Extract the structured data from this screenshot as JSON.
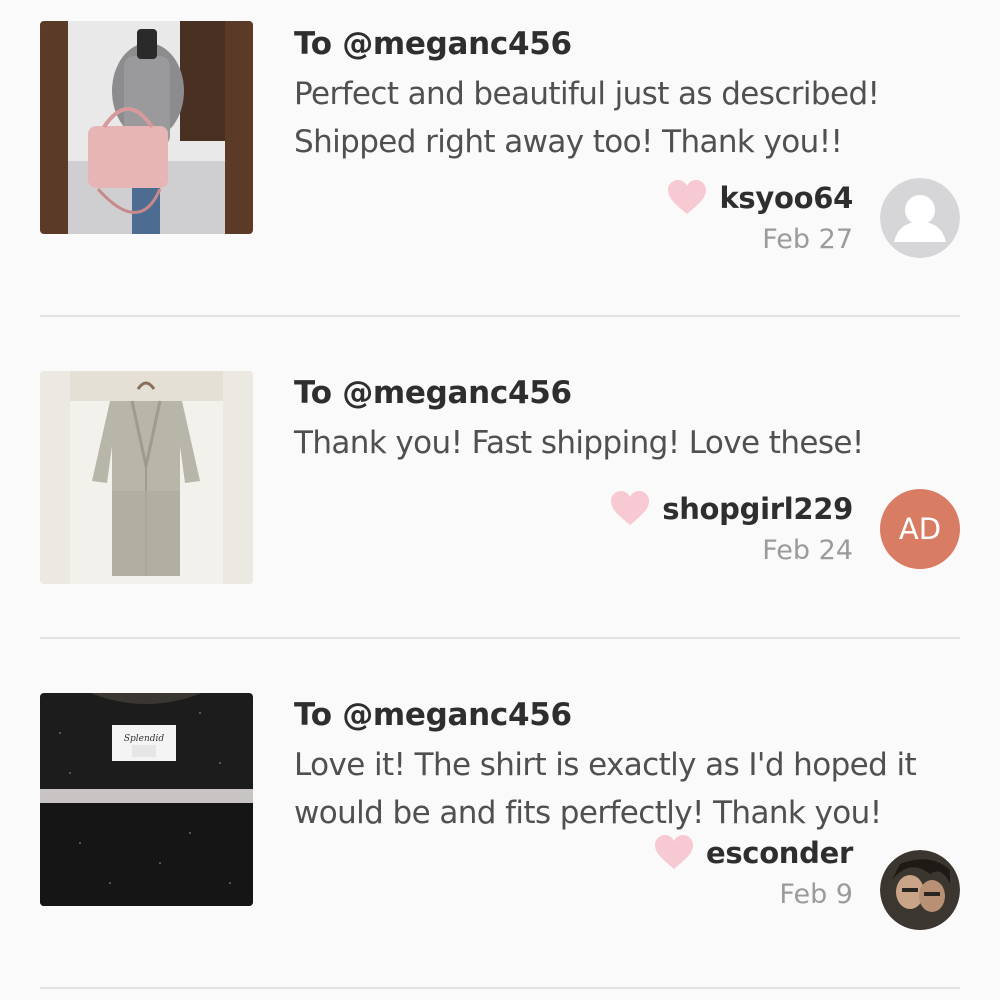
{
  "reviews": [
    {
      "recipient": "To @meganc456",
      "comment": "Perfect and beautiful just as described! Shipped right away too! Thank you!!",
      "username": "ksyoo64",
      "date": "Feb 27",
      "avatar_type": "default-silhouette",
      "thumb_subject": "mirror selfie with pink handbag"
    },
    {
      "recipient": "To @meganc456",
      "comment": "Thank you! Fast shipping! Love these!",
      "username": "shopgirl229",
      "date": "Feb 24",
      "avatar_type": "initials",
      "avatar_initials": "AD",
      "thumb_subject": "grey cardigan on hanger"
    },
    {
      "recipient": "To @meganc456",
      "comment": "Love it! The shirt is exactly as I'd hoped it would be and fits perfectly! Thank you!",
      "username": "esconder",
      "date": "Feb 9",
      "avatar_type": "photo",
      "thumb_subject": "black shirt with label",
      "thumb_label": "Splendid"
    }
  ],
  "icons": {
    "like": "heart-icon"
  },
  "colors": {
    "heart": "#f7c9d2",
    "initials_avatar": "#d97c64",
    "date_text": "#9b9b9b",
    "divider": "#e2e2e4"
  }
}
